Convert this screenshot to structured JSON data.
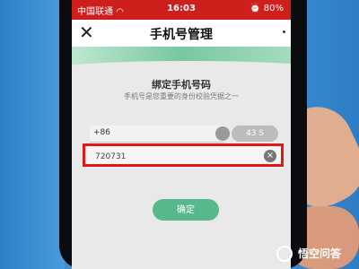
{
  "status_bar": {
    "carrier": "中国联通",
    "wifi_icon": "wifi-icon",
    "time": "16:03",
    "battery": "80%",
    "background_color": "#cf1f1c"
  },
  "header": {
    "close_icon": "close-icon",
    "title": "手机号管理"
  },
  "form": {
    "heading": "绑定手机号码",
    "subheading": "手机号是您重要的身份校验凭据之一",
    "phone_prefix": "+86",
    "countdown_label": "43 S",
    "code_value": "720731",
    "clear_icon": "clear-icon",
    "confirm_label": "确定",
    "accent_color": "#57b98b",
    "highlight_color": "#e01818"
  },
  "watermark": {
    "text": "悟空问答",
    "logo_icon": "wukong-logo-icon"
  }
}
